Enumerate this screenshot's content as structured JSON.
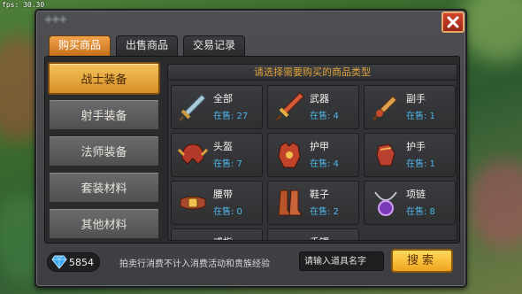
{
  "debug": {
    "fps": "fps: 30.30"
  },
  "tabs": [
    {
      "label": "购买商品",
      "active": true
    },
    {
      "label": "出售商品",
      "active": false
    },
    {
      "label": "交易记录",
      "active": false
    }
  ],
  "categories": [
    {
      "label": "战士装备",
      "active": true
    },
    {
      "label": "射手装备",
      "active": false
    },
    {
      "label": "法师装备",
      "active": false
    },
    {
      "label": "套装材料",
      "active": false
    },
    {
      "label": "其他材料",
      "active": false
    }
  ],
  "goods_header": "请选择需要购买的商品类型",
  "items": [
    {
      "name": "全部",
      "sale": "在售: 27",
      "icon": "sword-icon"
    },
    {
      "name": "武器",
      "sale": "在售: 4",
      "icon": "greatsword-icon"
    },
    {
      "name": "副手",
      "sale": "在售: 1",
      "icon": "dagger-icon"
    },
    {
      "name": "头盔",
      "sale": "在售: 7",
      "icon": "helmet-icon"
    },
    {
      "name": "护甲",
      "sale": "在售: 4",
      "icon": "armor-icon"
    },
    {
      "name": "护手",
      "sale": "在售: 1",
      "icon": "gauntlet-icon"
    },
    {
      "name": "腰带",
      "sale": "在售: 0",
      "icon": "belt-icon"
    },
    {
      "name": "鞋子",
      "sale": "在售: 2",
      "icon": "boots-icon"
    },
    {
      "name": "项链",
      "sale": "在售: 8",
      "icon": "necklace-icon"
    },
    {
      "name": "戒指",
      "sale": "",
      "icon": "ring-icon"
    },
    {
      "name": "手镯",
      "sale": "",
      "icon": "bracelet-icon"
    }
  ],
  "footer": {
    "currency_amount": "5854",
    "currency_icon": "diamond-icon",
    "notice": "拍卖行消费不计入消费活动和贵族经验",
    "search_placeholder": "请输入道具名字",
    "search_label": "搜索"
  }
}
